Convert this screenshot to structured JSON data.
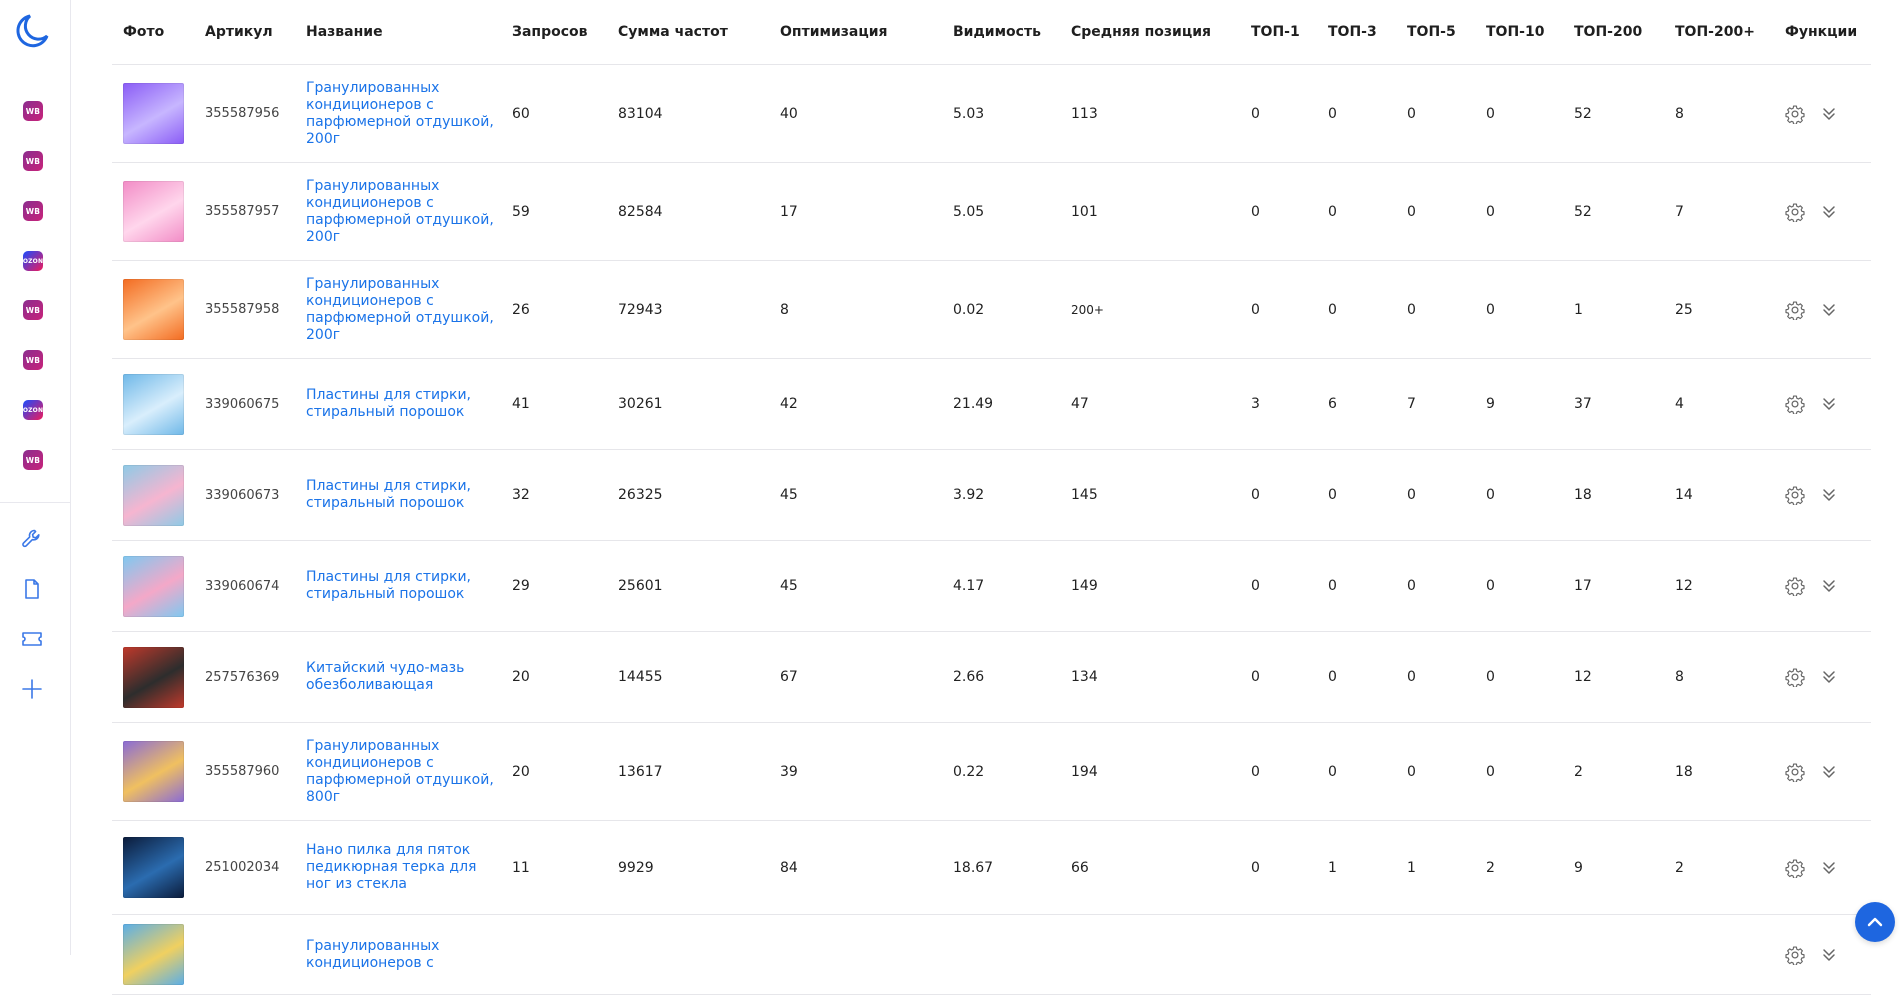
{
  "sidebar": {
    "marketplaces": [
      "WB",
      "WB",
      "WB",
      "OZON",
      "WB",
      "WB",
      "OZON",
      "WB"
    ],
    "tools": [
      "wrench-icon",
      "document-icon",
      "ticket-icon",
      "plus-icon"
    ]
  },
  "table": {
    "headers": [
      "Фото",
      "Артикул",
      "Название",
      "Запросов",
      "Сумма частот",
      "Оптимизация",
      "Видимость",
      "Средняя позиция",
      "ТОП-1",
      "ТОП-3",
      "ТОП-5",
      "ТОП-10",
      "ТОП-200",
      "ТОП-200+",
      "Функции"
    ],
    "rows": [
      {
        "article": "355587956",
        "name": "Гранулированных кондиционеров с парфюмерной отдушкой, 200г",
        "requests": "60",
        "freq_sum": "83104",
        "optimization": "40",
        "visibility": "5.03",
        "avg_pos": "113",
        "top1": "0",
        "top3": "0",
        "top5": "0",
        "top10": "0",
        "top200": "52",
        "top200plus": "8"
      },
      {
        "article": "355587957",
        "name": "Гранулированных кондиционеров с парфюмерной отдушкой, 200г",
        "requests": "59",
        "freq_sum": "82584",
        "optimization": "17",
        "visibility": "5.05",
        "avg_pos": "101",
        "top1": "0",
        "top3": "0",
        "top5": "0",
        "top10": "0",
        "top200": "52",
        "top200plus": "7"
      },
      {
        "article": "355587958",
        "name": "Гранулированных кондиционеров с парфюмерной отдушкой, 200г",
        "requests": "26",
        "freq_sum": "72943",
        "optimization": "8",
        "visibility": "0.02",
        "avg_pos": "200+",
        "top1": "0",
        "top3": "0",
        "top5": "0",
        "top10": "0",
        "top200": "1",
        "top200plus": "25"
      },
      {
        "article": "339060675",
        "name": "Пластины для стирки, стиральный порошок",
        "requests": "41",
        "freq_sum": "30261",
        "optimization": "42",
        "visibility": "21.49",
        "avg_pos": "47",
        "top1": "3",
        "top3": "6",
        "top5": "7",
        "top10": "9",
        "top200": "37",
        "top200plus": "4"
      },
      {
        "article": "339060673",
        "name": "Пластины для стирки, стиральный порошок",
        "requests": "32",
        "freq_sum": "26325",
        "optimization": "45",
        "visibility": "3.92",
        "avg_pos": "145",
        "top1": "0",
        "top3": "0",
        "top5": "0",
        "top10": "0",
        "top200": "18",
        "top200plus": "14"
      },
      {
        "article": "339060674",
        "name": "Пластины для стирки, стиральный порошок",
        "requests": "29",
        "freq_sum": "25601",
        "optimization": "45",
        "visibility": "4.17",
        "avg_pos": "149",
        "top1": "0",
        "top3": "0",
        "top5": "0",
        "top10": "0",
        "top200": "17",
        "top200plus": "12"
      },
      {
        "article": "257576369",
        "name": "Китайский чудо-мазь обезболивающая",
        "requests": "20",
        "freq_sum": "14455",
        "optimization": "67",
        "visibility": "2.66",
        "avg_pos": "134",
        "top1": "0",
        "top3": "0",
        "top5": "0",
        "top10": "0",
        "top200": "12",
        "top200plus": "8"
      },
      {
        "article": "355587960",
        "name": "Гранулированных кондиционеров с парфюмерной отдушкой, 800г",
        "requests": "20",
        "freq_sum": "13617",
        "optimization": "39",
        "visibility": "0.22",
        "avg_pos": "194",
        "top1": "0",
        "top3": "0",
        "top5": "0",
        "top10": "0",
        "top200": "2",
        "top200plus": "18"
      },
      {
        "article": "251002034",
        "name": "Нано пилка для пяток педикюрная терка для ног из стекла",
        "requests": "11",
        "freq_sum": "9929",
        "optimization": "84",
        "visibility": "18.67",
        "avg_pos": "66",
        "top1": "0",
        "top3": "1",
        "top5": "1",
        "top10": "2",
        "top200": "9",
        "top200plus": "2"
      },
      {
        "article": "",
        "name": "Гранулированных кондиционеров с",
        "requests": "",
        "freq_sum": "",
        "optimization": "",
        "visibility": "",
        "avg_pos": "",
        "top1": "",
        "top3": "",
        "top5": "",
        "top10": "",
        "top200": "",
        "top200plus": ""
      }
    ]
  },
  "colors": {
    "link": "#1a73e8",
    "accent": "#1e66e0",
    "wb_badge": "#a0288a",
    "ozon_badge": "#1a4cff"
  }
}
